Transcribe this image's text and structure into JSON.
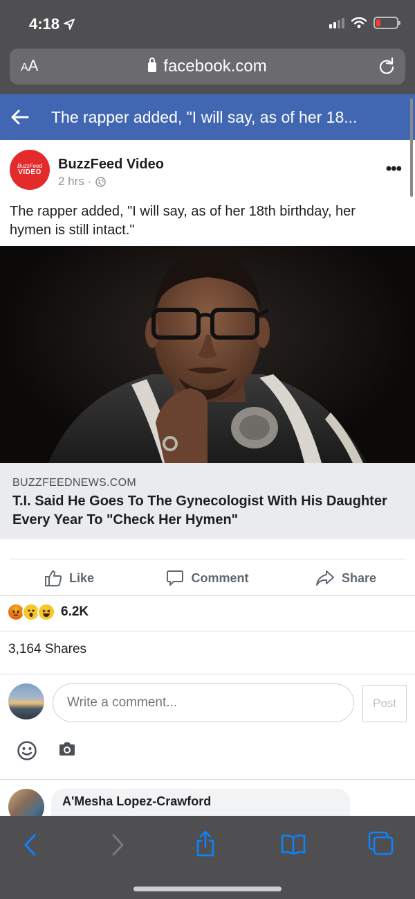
{
  "status_bar": {
    "time": "4:18"
  },
  "browser": {
    "text_size_label": "AA",
    "domain": "facebook.com"
  },
  "fb_header": {
    "title": "The rapper added, \"I will say, as of her 18..."
  },
  "post": {
    "page_name": "BuzzFeed Video",
    "avatar_line1": "BuzzFeed",
    "avatar_line2": "VIDEO",
    "time": "2 hrs ·",
    "text": "The rapper added, \"I will say, as of her 18th birthday, her hymen is still intact.\"",
    "link": {
      "domain": "BUZZFEEDNEWS.COM",
      "title": "T.I. Said He Goes To The Gynecologist With His Daughter Every Year To \"Check Her Hymen\""
    },
    "actions": {
      "like": "Like",
      "comment": "Comment",
      "share": "Share"
    },
    "reactions": {
      "icons": [
        "angry",
        "wow",
        "haha"
      ],
      "count": "6.2K"
    },
    "shares": "3,164 Shares"
  },
  "composer": {
    "placeholder": "Write a comment...",
    "post_label": "Post"
  },
  "comments": [
    {
      "author": "A'Mesha Lopez-Crawford"
    }
  ],
  "colors": {
    "fb_blue": "#4267b2",
    "safari_chrome": "#4f4f52",
    "ios_blue": "#0a84ff"
  }
}
